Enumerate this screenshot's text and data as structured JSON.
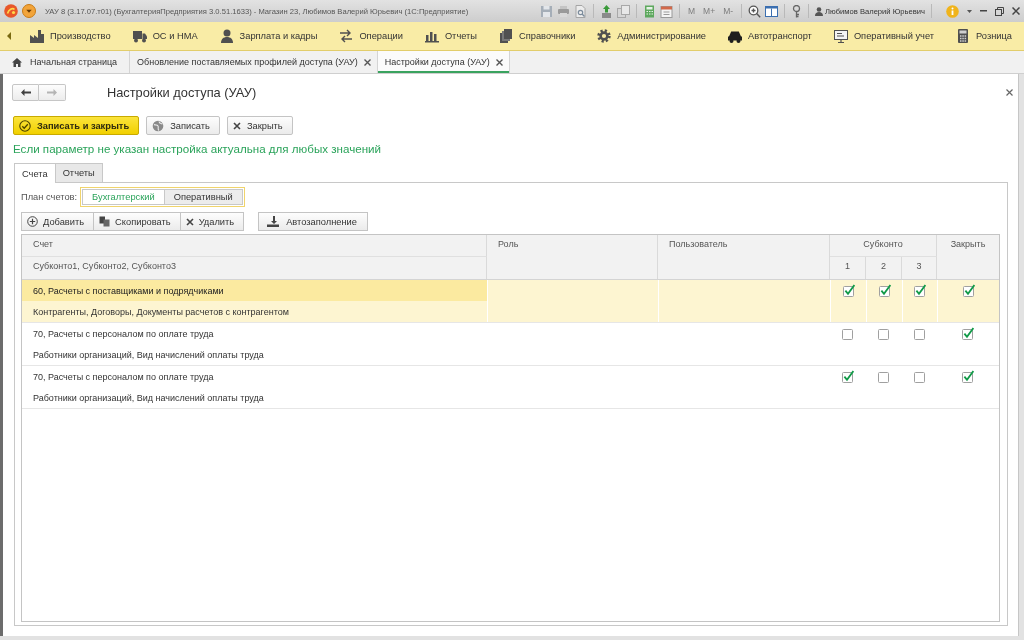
{
  "window": {
    "title": "УАУ 8 (3.17.07.т01) (БухгалтерияПредприятия 3.0.51.1633) - Магазин 23, Любимов Валерий Юрьевич (1С:Предприятие)",
    "memory_buttons": [
      {
        "label": "M",
        "disabled": true
      },
      {
        "label": "M+",
        "disabled": true
      },
      {
        "label": "M-",
        "disabled": true
      }
    ],
    "user": "Любимов Валерий Юрьевич"
  },
  "sections": [
    {
      "label": "Производство",
      "kind": "factory"
    },
    {
      "label": "ОС и НМА",
      "kind": "truck"
    },
    {
      "label": "Зарплата и кадры",
      "kind": "person"
    },
    {
      "label": "Операции",
      "kind": "transfer"
    },
    {
      "label": "Отчеты",
      "kind": "chart"
    },
    {
      "label": "Справочники",
      "kind": "books"
    },
    {
      "label": "Администрирование",
      "kind": "gear"
    },
    {
      "label": "Автотранспорт",
      "kind": "car"
    },
    {
      "label": "Оперативный учет",
      "kind": "board"
    },
    {
      "label": "Розница",
      "kind": "calculator"
    }
  ],
  "open_tabs": [
    {
      "label": "Начальная страница",
      "kind": "home",
      "selected": false
    },
    {
      "label": "Обновление поставляемых профилей доступа (УАУ)",
      "kind": "document",
      "selected": false
    },
    {
      "label": "Настройки доступа (УАУ)",
      "kind": "document",
      "selected": true
    }
  ],
  "form": {
    "navigation": [
      {
        "kind": "back",
        "disabled": false
      },
      {
        "kind": "forward",
        "disabled": true
      }
    ],
    "title": "Настройки доступа (УАУ)",
    "buttons": [
      {
        "label": "Записать и закрыть",
        "kind": "save_close",
        "default": true
      },
      {
        "label": "Записать",
        "kind": "save",
        "default": false
      },
      {
        "label": "Закрыть",
        "kind": "close",
        "default": false
      }
    ],
    "hint": "Если параметр не указан настройка актуальна для любых значений",
    "tabs": [
      {
        "label": "Счета",
        "selected": true
      },
      {
        "label": "Отчеты",
        "selected": false
      }
    ],
    "chart_of_accounts": {
      "label": "План счетов:",
      "options": [
        {
          "label": "Бухгалтерский",
          "selected": true
        },
        {
          "label": "Оперативный",
          "selected": false
        }
      ]
    },
    "row_actions": [
      {
        "label": "Добавить",
        "kind": "add"
      },
      {
        "label": "Скопировать",
        "kind": "copy"
      },
      {
        "label": "Удалить",
        "kind": "delete"
      }
    ],
    "autofill_button": {
      "label": "Автозаполнение"
    },
    "table": {
      "columns": {
        "account": "Счет",
        "subconto_types": "Субконто1, Субконто2, Субконто3",
        "role": "Роль",
        "user": "Пользователь",
        "subconto": "Субконто",
        "subconto_numbers": [
          "1",
          "2",
          "3"
        ],
        "close": "Закрыть"
      },
      "rows": [
        {
          "account": "60, Расчеты с поставщиками и подрядчиками",
          "subconto_types": "Контрагенты, Договоры, Документы расчетов с контрагентом",
          "selected": true,
          "subconto": [
            {
              "checked": true
            },
            {
              "checked": true
            },
            {
              "checked": true
            }
          ],
          "close": {
            "checked": true
          }
        },
        {
          "account": "70, Расчеты с персоналом по оплате труда",
          "subconto_types": "Работники организаций, Вид начислений оплаты труда",
          "selected": false,
          "subconto": [
            {
              "checked": false
            },
            {
              "checked": false
            },
            {
              "checked": false
            }
          ],
          "close": {
            "checked": true
          }
        },
        {
          "account": "70, Расчеты с персоналом по оплате труда",
          "subconto_types": "Работники организаций, Вид начислений оплаты труда",
          "selected": false,
          "subconto": [
            {
              "checked": true
            },
            {
              "checked": false
            },
            {
              "checked": false
            }
          ],
          "close": {
            "checked": true
          }
        }
      ]
    }
  }
}
